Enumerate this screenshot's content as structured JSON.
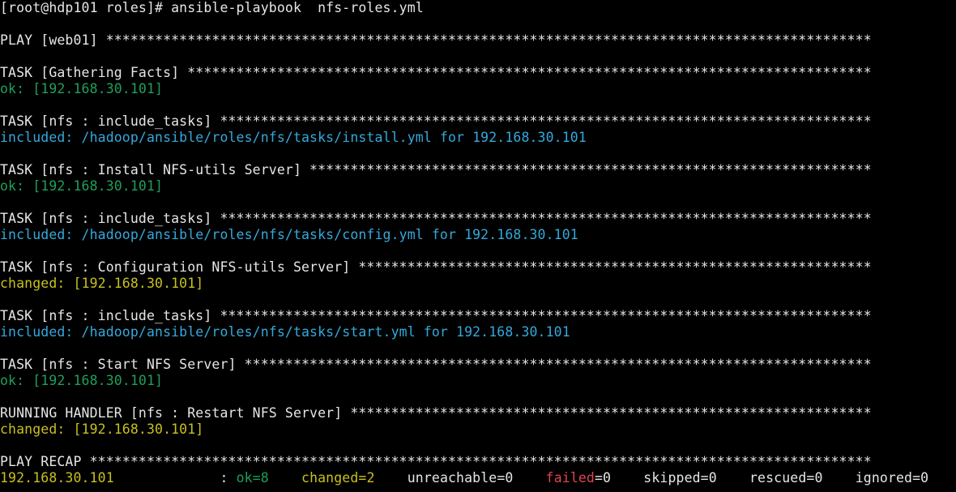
{
  "colors": {
    "background": "#000000",
    "text": "#e6e6e6",
    "ok": "#1ea05a",
    "included": "#35a9dc",
    "changed": "#c8c01e",
    "failed": "#e0434f"
  },
  "lines": [
    {
      "segments": [
        {
          "text": "[root@hdp101 roles]# ansible-playbook  nfs-roles.yml",
          "color": "white"
        }
      ]
    },
    {
      "segments": []
    },
    {
      "segments": [
        {
          "text": "PLAY [web01] **********************************************************************************************",
          "color": "white"
        }
      ]
    },
    {
      "segments": []
    },
    {
      "segments": [
        {
          "text": "TASK [Gathering Facts] ************************************************************************************",
          "color": "white"
        }
      ]
    },
    {
      "segments": [
        {
          "text": "ok: [192.168.30.101]",
          "color": "green"
        }
      ]
    },
    {
      "segments": []
    },
    {
      "segments": [
        {
          "text": "TASK [nfs : include_tasks] ********************************************************************************",
          "color": "white"
        }
      ]
    },
    {
      "segments": [
        {
          "text": "included: /hadoop/ansible/roles/nfs/tasks/install.yml for 192.168.30.101",
          "color": "cyan"
        }
      ]
    },
    {
      "segments": []
    },
    {
      "segments": [
        {
          "text": "TASK [nfs : Install NFS-utils Server] *********************************************************************",
          "color": "white"
        }
      ]
    },
    {
      "segments": [
        {
          "text": "ok: [192.168.30.101]",
          "color": "green"
        }
      ]
    },
    {
      "segments": []
    },
    {
      "segments": [
        {
          "text": "TASK [nfs : include_tasks] ********************************************************************************",
          "color": "white"
        }
      ]
    },
    {
      "segments": [
        {
          "text": "included: /hadoop/ansible/roles/nfs/tasks/config.yml for 192.168.30.101",
          "color": "cyan"
        }
      ]
    },
    {
      "segments": []
    },
    {
      "segments": [
        {
          "text": "TASK [nfs : Configuration NFS-utils Server] ***************************************************************",
          "color": "white"
        }
      ]
    },
    {
      "segments": [
        {
          "text": "changed: [192.168.30.101]",
          "color": "yellow"
        }
      ]
    },
    {
      "segments": []
    },
    {
      "segments": [
        {
          "text": "TASK [nfs : include_tasks] ********************************************************************************",
          "color": "white"
        }
      ]
    },
    {
      "segments": [
        {
          "text": "included: /hadoop/ansible/roles/nfs/tasks/start.yml for 192.168.30.101",
          "color": "cyan"
        }
      ]
    },
    {
      "segments": []
    },
    {
      "segments": [
        {
          "text": "TASK [nfs : Start NFS Server] *****************************************************************************",
          "color": "white"
        }
      ]
    },
    {
      "segments": [
        {
          "text": "ok: [192.168.30.101]",
          "color": "green"
        }
      ]
    },
    {
      "segments": []
    },
    {
      "segments": [
        {
          "text": "RUNNING HANDLER [nfs : Restart NFS Server] ****************************************************************",
          "color": "white"
        }
      ]
    },
    {
      "segments": [
        {
          "text": "changed: [192.168.30.101]",
          "color": "yellow"
        }
      ]
    },
    {
      "segments": []
    },
    {
      "segments": [
        {
          "text": "PLAY RECAP ************************************************************************************************",
          "color": "white"
        }
      ]
    },
    {
      "segments": [
        {
          "text": "192.168.30.101",
          "color": "yellow"
        },
        {
          "text": "             : ",
          "color": "white"
        },
        {
          "text": "ok=8",
          "color": "green"
        },
        {
          "text": "    ",
          "color": "white"
        },
        {
          "text": "changed=2",
          "color": "yellow"
        },
        {
          "text": "    unreachable=0    ",
          "color": "white"
        },
        {
          "text": "failed",
          "color": "red"
        },
        {
          "text": "=0    skipped=0    rescued=0    ignored=0",
          "color": "white"
        }
      ]
    }
  ]
}
